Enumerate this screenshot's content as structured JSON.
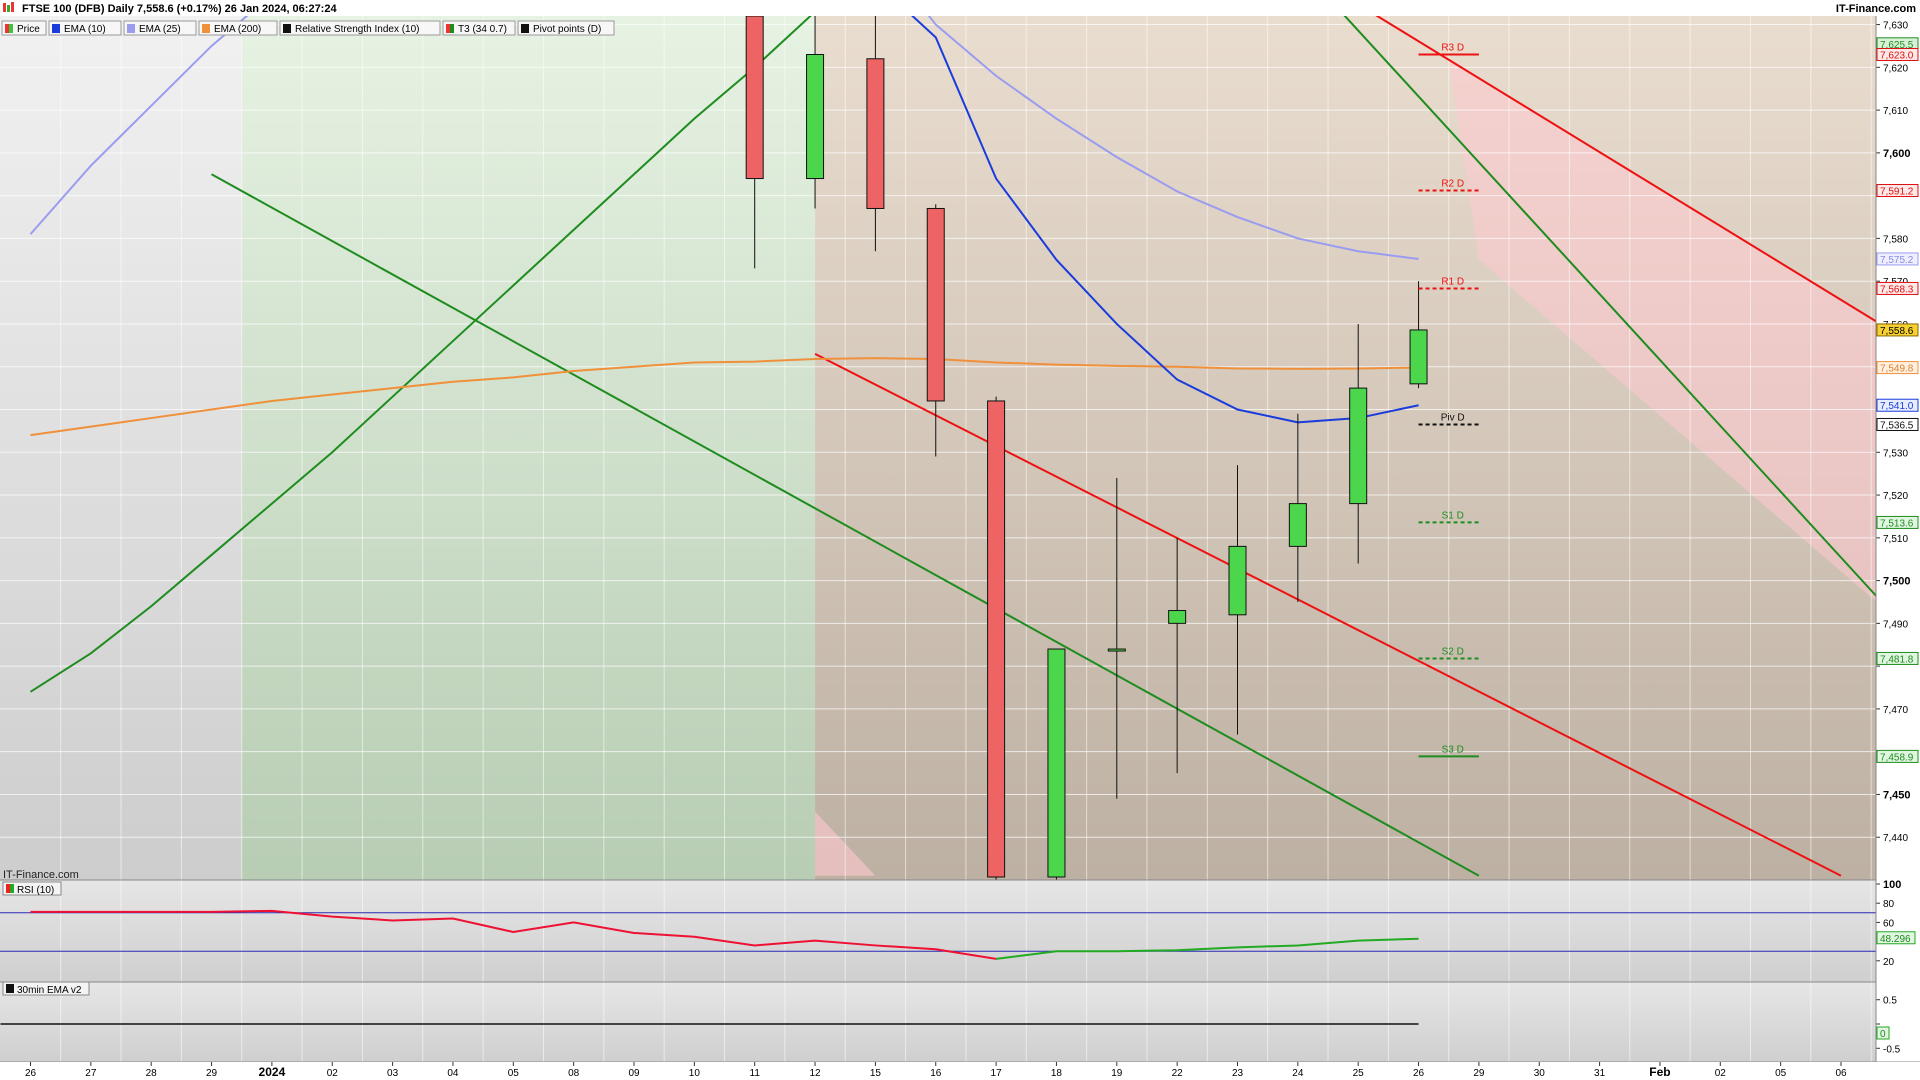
{
  "header": {
    "title": "FTSE 100 (DFB) Daily 7,558.6 (+0.17%) 26 Jan 2024, 06:27:24",
    "brand": "IT-Finance.com",
    "legend": [
      {
        "label": "Price",
        "color": "#3cc43c"
      },
      {
        "label": "EMA (10)",
        "color": "#1a3cdc"
      },
      {
        "label": "EMA (25)",
        "color": "#9a9cf0"
      },
      {
        "label": "EMA (200)",
        "color": "#f0903a"
      },
      {
        "label": "Relative Strength Index (10)",
        "color": "#111111"
      },
      {
        "label": "T3 (34 0.7)",
        "color": "#1e8c1e"
      },
      {
        "label": "Pivot points (D)",
        "color": "#111111"
      }
    ]
  },
  "watermark": "IT-Finance.com",
  "colors": {
    "up": "#4cd64c",
    "down": "#ee6464",
    "ema10": "#1a3cdc",
    "ema25": "#9a9cf0",
    "ema200": "#f0903a",
    "t3": "#1e8c1e",
    "trend_red": "#ee1111",
    "trend_green": "#1e8c1e",
    "rsi_down": "#ee1133",
    "rsi_up": "#22aa22",
    "band": "#2a2ab8"
  },
  "chart_data": [
    {
      "type": "candlestick",
      "title": "FTSE 100 (DFB) Daily",
      "ylim": [
        7430,
        7632
      ],
      "yticks": [
        7440,
        7450,
        7460,
        7470,
        7480,
        7490,
        7500,
        7510,
        7520,
        7530,
        7540,
        7550,
        7560,
        7570,
        7580,
        7590,
        7600,
        7610,
        7620,
        7630
      ],
      "ytick_labels": [
        "7,440",
        "7,450",
        "",
        "7,470",
        "",
        "7,490",
        "7,500",
        "7,510",
        "7,520",
        "7,530",
        "",
        "",
        "7,560",
        "7,570",
        "7,580",
        "",
        "7,600",
        "7,610",
        "7,620",
        "7,630"
      ],
      "bold_ticks": [
        7450,
        7500,
        7550,
        7600
      ],
      "x_slots": 31,
      "x_labels": [
        "26",
        "27",
        "28",
        "29",
        "2024",
        "02",
        "03",
        "04",
        "05",
        "08",
        "09",
        "10",
        "11",
        "12",
        "15",
        "16",
        "17",
        "18",
        "19",
        "22",
        "23",
        "24",
        "25",
        "26",
        "29",
        "30",
        "31",
        "Feb",
        "02",
        "05",
        "06"
      ],
      "bold_x_labels": [
        "2024",
        "Feb"
      ],
      "candles": [
        {
          "date": "11 Jan",
          "slot": 12,
          "open": 7660,
          "high": 7670,
          "low": 7573,
          "close": 7594
        },
        {
          "date": "12 Jan",
          "slot": 13,
          "open": 7594,
          "high": 7648,
          "low": 7587,
          "close": 7623
        },
        {
          "date": "15 Jan",
          "slot": 14,
          "open": 7622,
          "high": 7640,
          "low": 7577,
          "close": 7587
        },
        {
          "date": "16 Jan",
          "slot": 15,
          "open": 7587,
          "high": 7588,
          "low": 7529,
          "close": 7542
        },
        {
          "date": "17 Jan",
          "slot": 16,
          "open": 7542,
          "high": 7543,
          "low": 7429,
          "close": 7430
        },
        {
          "date": "18 Jan",
          "slot": 17,
          "open": 7430,
          "high": 7484,
          "low": 7429,
          "close": 7484
        },
        {
          "date": "19 Jan",
          "slot": 18,
          "open": 7484,
          "high": 7524,
          "low": 7449,
          "close": 7484
        },
        {
          "date": "22 Jan",
          "slot": 19,
          "open": 7490,
          "high": 7510,
          "low": 7455,
          "close": 7493
        },
        {
          "date": "23 Jan",
          "slot": 20,
          "open": 7492,
          "high": 7527,
          "low": 7464,
          "close": 7508
        },
        {
          "date": "24 Jan",
          "slot": 21,
          "open": 7508,
          "high": 7539,
          "low": 7495,
          "close": 7518
        },
        {
          "date": "25 Jan",
          "slot": 22,
          "open": 7518,
          "high": 7560,
          "low": 7504,
          "close": 7545
        },
        {
          "date": "26 Jan",
          "slot": 23,
          "open": 7546,
          "high": 7570,
          "low": 7545,
          "close": 7558.6
        }
      ],
      "series": [
        {
          "key": "ema200",
          "values": [
            [
              0,
              7534
            ],
            [
              1,
              7536
            ],
            [
              2,
              7538
            ],
            [
              3,
              7540
            ],
            [
              4,
              7542
            ],
            [
              5,
              7543.5
            ],
            [
              6,
              7545
            ],
            [
              7,
              7546.5
            ],
            [
              8,
              7547.5
            ],
            [
              9,
              7549
            ],
            [
              10,
              7550
            ],
            [
              11,
              7551
            ],
            [
              12,
              7551.2
            ],
            [
              13,
              7551.8
            ],
            [
              14,
              7552
            ],
            [
              15,
              7551.8
            ],
            [
              16,
              7551
            ],
            [
              17,
              7550.5
            ],
            [
              18,
              7550.2
            ],
            [
              19,
              7550
            ],
            [
              20,
              7549.6
            ],
            [
              21,
              7549.5
            ],
            [
              22,
              7549.6
            ],
            [
              23,
              7549.8
            ]
          ]
        },
        {
          "key": "ema25",
          "values": [
            [
              0,
              7581
            ],
            [
              1,
              7597
            ],
            [
              2,
              7611
            ],
            [
              3,
              7625
            ],
            [
              4,
              7637
            ],
            [
              5,
              7645
            ],
            [
              12,
              7670
            ],
            [
              13,
              7660
            ],
            [
              14,
              7648
            ],
            [
              15,
              7630
            ],
            [
              16,
              7618
            ],
            [
              17,
              7608
            ],
            [
              18,
              7599
            ],
            [
              19,
              7591
            ],
            [
              20,
              7585
            ],
            [
              21,
              7580
            ],
            [
              22,
              7577
            ],
            [
              23,
              7575.2
            ]
          ]
        },
        {
          "key": "ema10",
          "values": [
            [
              14,
              7640
            ],
            [
              15,
              7627
            ],
            [
              16,
              7594
            ],
            [
              17,
              7575
            ],
            [
              18,
              7560
            ],
            [
              19,
              7547
            ],
            [
              20,
              7540
            ],
            [
              21,
              7537
            ],
            [
              22,
              7538
            ],
            [
              23,
              7541
            ]
          ]
        },
        {
          "key": "t3",
          "values": [
            [
              0,
              7474
            ],
            [
              1,
              7483
            ],
            [
              2,
              7494
            ],
            [
              3,
              7506
            ],
            [
              4,
              7518
            ],
            [
              5,
              7530
            ],
            [
              6,
              7543
            ],
            [
              7,
              7556
            ],
            [
              8,
              7569
            ],
            [
              9,
              7582
            ],
            [
              10,
              7595
            ],
            [
              11,
              7608
            ],
            [
              12,
              7620
            ],
            [
              13,
              7633
            ],
            [
              14,
              7645
            ],
            [
              15,
              7656
            ],
            [
              16,
              7667
            ],
            [
              17,
              7676
            ],
            [
              18,
              7683
            ],
            [
              19,
              7689
            ],
            [
              20,
              7694
            ],
            [
              21,
              7698
            ],
            [
              22,
              7701
            ],
            [
              23,
              7703
            ]
          ]
        },
        {
          "key": "trend_red_upper",
          "values": [
            [
              20,
              7652
            ],
            [
              31,
              7557
            ]
          ]
        },
        {
          "key": "trend_red_lower",
          "values": [
            [
              13,
              7553
            ],
            [
              30,
              7431
            ]
          ]
        },
        {
          "key": "trend_green_upper",
          "values": [
            [
              21,
              7644
            ],
            [
              31,
              7490
            ]
          ]
        },
        {
          "key": "trend_green_lower",
          "values": [
            [
              3,
              7595
            ],
            [
              24,
              7431
            ]
          ]
        }
      ],
      "pivots": [
        {
          "label": "R3 D",
          "value": 7623.0,
          "style": "solid",
          "color": "#ee1111"
        },
        {
          "label": "R2 D",
          "value": 7591.2,
          "style": "dashed",
          "color": "#ee1111"
        },
        {
          "label": "R1 D",
          "value": 7568.3,
          "style": "dashed",
          "color": "#ee1111"
        },
        {
          "label": "Piv D",
          "value": 7536.5,
          "style": "dashed",
          "color": "#111111"
        },
        {
          "label": "S1 D",
          "value": 7513.6,
          "style": "dashed",
          "color": "#1e8c1e"
        },
        {
          "label": "S2 D",
          "value": 7481.8,
          "style": "dashed",
          "color": "#1e8c1e"
        },
        {
          "label": "S3 D",
          "value": 7458.9,
          "style": "solid",
          "color": "#1e8c1e"
        }
      ],
      "axis_badges": [
        {
          "label": "7,625.5",
          "value": 7625.5,
          "bg": "#d8f0d8",
          "fg": "#1e8c1e",
          "border": "#1e8c1e"
        },
        {
          "label": "7,623.0",
          "value": 7623.0,
          "bg": "#ffe8e8",
          "fg": "#dd1111",
          "border": "#dd1111"
        },
        {
          "label": "7,591.2",
          "value": 7591.2,
          "bg": "#ffe8e8",
          "fg": "#dd1111",
          "border": "#dd1111"
        },
        {
          "label": "7,575.2",
          "value": 7575.2,
          "bg": "#eeeeff",
          "fg": "#8a8ce0",
          "border": "#9a9cf0"
        },
        {
          "label": "7,568.3",
          "value": 7568.3,
          "bg": "#ffe8e8",
          "fg": "#dd1111",
          "border": "#dd1111"
        },
        {
          "label": "7,558.6",
          "value": 7558.6,
          "bg": "#f6d030",
          "fg": "#000000",
          "border": "#8a6a00"
        },
        {
          "label": "7,549.8",
          "value": 7549.8,
          "bg": "#fff0e0",
          "fg": "#e08030",
          "border": "#f0903a"
        },
        {
          "label": "7,541.0",
          "value": 7541.0,
          "bg": "#e8ecff",
          "fg": "#1a3cdc",
          "border": "#1a3cdc"
        },
        {
          "label": "7,536.5",
          "value": 7536.5,
          "bg": "#ffffff",
          "fg": "#111111",
          "border": "#111111"
        },
        {
          "label": "7,513.6",
          "value": 7513.6,
          "bg": "#e0f6e0",
          "fg": "#1e8c1e",
          "border": "#1e8c1e"
        },
        {
          "label": "7,481.8",
          "value": 7481.8,
          "bg": "#e0f6e0",
          "fg": "#1e8c1e",
          "border": "#1e8c1e"
        },
        {
          "label": "7,458.9",
          "value": 7458.9,
          "bg": "#e0f6e0",
          "fg": "#1e8c1e",
          "border": "#1e8c1e"
        }
      ],
      "zones": [
        {
          "fill": "green",
          "from_slot": 3.5,
          "to_slot": 13
        },
        {
          "fill": "brown",
          "from_slot": 13,
          "to_slot": 31
        }
      ]
    },
    {
      "type": "line",
      "title": "RSI (10)",
      "ylim": [
        0,
        100
      ],
      "yticks": [
        20,
        60,
        80,
        100
      ],
      "ytick_labels": [
        "20",
        "60",
        "80",
        "100"
      ],
      "bands": [
        30,
        70
      ],
      "values": [
        [
          0,
          71
        ],
        [
          1,
          71
        ],
        [
          2,
          71
        ],
        [
          3,
          71
        ],
        [
          4,
          72
        ],
        [
          5,
          66
        ],
        [
          6,
          62
        ],
        [
          7,
          64
        ],
        [
          8,
          50
        ],
        [
          9,
          60
        ],
        [
          10,
          49
        ],
        [
          11,
          45
        ],
        [
          12,
          36
        ],
        [
          13,
          41
        ],
        [
          14,
          36
        ],
        [
          15,
          32
        ],
        [
          16,
          22
        ],
        [
          17,
          30
        ],
        [
          18,
          30
        ],
        [
          19,
          31
        ],
        [
          20,
          34
        ],
        [
          21,
          36
        ],
        [
          22,
          41
        ],
        [
          23,
          43
        ]
      ],
      "down_until": 16,
      "badge": {
        "label": "48.296",
        "value": 44
      }
    },
    {
      "type": "line",
      "title": "30min EMA v2",
      "ylim": [
        -0.7,
        0.7
      ],
      "yticks": [
        0.5,
        0,
        -0.5
      ],
      "ytick_labels": [
        "0.5",
        "0",
        "-0.5"
      ],
      "values": [
        [
          0,
          0
        ],
        [
          23,
          0
        ]
      ],
      "badge": {
        "label": "0",
        "value": 0
      }
    }
  ]
}
